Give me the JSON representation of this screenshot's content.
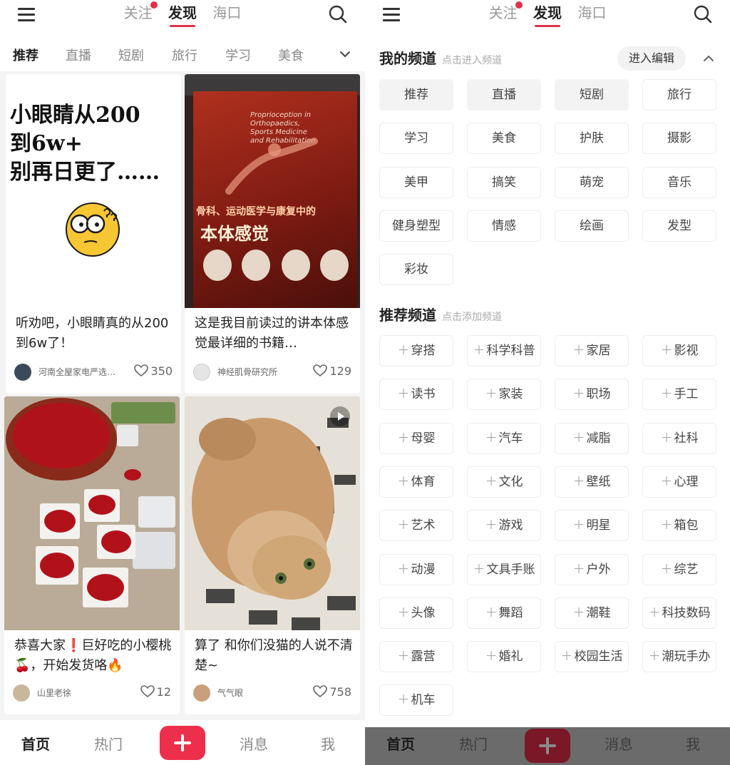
{
  "top_tabs": [
    "关注",
    "发现",
    "海口"
  ],
  "channels_bar": [
    "推荐",
    "直播",
    "短剧",
    "旅行",
    "学习",
    "美食"
  ],
  "feed": [
    {
      "title": "听劝吧，小眼睛真的从200到6w了！",
      "author": "河南全屋家电严选…",
      "likes": "350",
      "cover_text": [
        "小眼睛从200",
        "到6w+",
        "别再日更了……"
      ]
    },
    {
      "title": "这是我目前读过的讲本体感觉最详细的书籍…",
      "author": "神经肌骨研究所",
      "likes": "129",
      "cover_text": [
        "Proprioception in",
        "Orthopaedics,",
        "Sports Medicine",
        "and Rehabilitation",
        "骨科、运动医学与康复中的",
        "本体感觉"
      ]
    },
    {
      "title": "恭喜大家❗️巨好吃的小樱桃🍒，开始发货咯🔥",
      "author": "山里老徐",
      "likes": "12"
    },
    {
      "title": "算了 和你们没猫的人说不清楚~",
      "author": "气气眼",
      "likes": "758"
    }
  ],
  "bottom_nav": {
    "home": "首页",
    "hot": "热门",
    "messages": "消息",
    "me": "我"
  },
  "my_channels": {
    "title": "我的频道",
    "hint": "点击进入频道",
    "edit": "进入编辑",
    "items": [
      "推荐",
      "直播",
      "短剧",
      "旅行",
      "学习",
      "美食",
      "护肤",
      "摄影",
      "美甲",
      "搞笑",
      "萌宠",
      "音乐",
      "健身塑型",
      "情感",
      "绘画",
      "发型",
      "彩妆"
    ]
  },
  "recommended_channels": {
    "title": "推荐频道",
    "hint": "点击添加频道",
    "items": [
      "穿搭",
      "科学科普",
      "家居",
      "影视",
      "读书",
      "家装",
      "职场",
      "手工",
      "母婴",
      "汽车",
      "减脂",
      "社科",
      "体育",
      "文化",
      "壁纸",
      "心理",
      "艺术",
      "游戏",
      "明星",
      "箱包",
      "动漫",
      "文具手账",
      "户外",
      "综艺",
      "头像",
      "舞蹈",
      "潮鞋",
      "科技数码",
      "露营",
      "婚礼",
      "校园生活",
      "潮玩手办",
      "机车"
    ]
  },
  "colors": {
    "accent": "#e0314a",
    "add_button": "#ee2f4c"
  }
}
